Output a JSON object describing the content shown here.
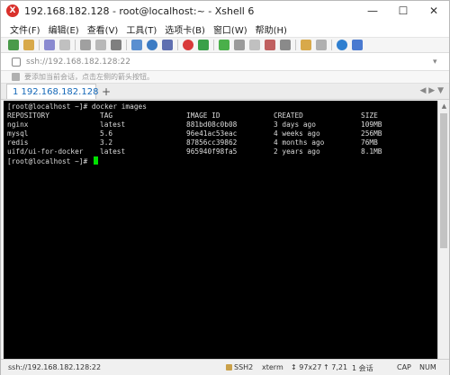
{
  "window": {
    "title": "192.168.182.128 - root@localhost:~ - Xshell 6",
    "icon": "xshell-icon"
  },
  "controls": {
    "minimize": "—",
    "maximize": "☐",
    "close": "✕"
  },
  "menu": [
    "文件(F)",
    "编辑(E)",
    "查看(V)",
    "工具(T)",
    "选项卡(B)",
    "窗口(W)",
    "帮助(H)"
  ],
  "address": {
    "value": "ssh://192.168.182.128:22"
  },
  "hint": {
    "text": "要添加当前会话，点击左侧的箭头按钮。"
  },
  "tab": {
    "label": "1 192.168.182.128",
    "add": "+",
    "nav": "◀ ▶ ▼"
  },
  "terminal": {
    "command_line": "[root@localhost ~]# docker images",
    "headers": [
      "REPOSITORY",
      "TAG",
      "IMAGE ID",
      "CREATED",
      "SIZE"
    ],
    "rows": [
      [
        "nginx",
        "latest",
        "881bd08c0b08",
        "3 days ago",
        "109MB"
      ],
      [
        "mysql",
        "5.6",
        "96e41ac53eac",
        "4 weeks ago",
        "256MB"
      ],
      [
        "redis",
        "3.2",
        "87856cc39862",
        "4 months ago",
        "76MB"
      ],
      [
        "uifd/ui-for-docker",
        "latest",
        "965940f98fa5",
        "2 years ago",
        "8.1MB"
      ]
    ],
    "prompt": "[root@localhost ~]# ",
    "colors": {
      "background": "#000000",
      "text": "#dcdcdc",
      "cursor": "#00e000"
    }
  },
  "status": {
    "address": "ssh://192.168.182.128:22",
    "protocol": "SSH2",
    "terminal_type": "xterm",
    "size": "97x27",
    "position": "7,21",
    "sessions": "1 会话",
    "caps": "CAP",
    "num": "NUM"
  },
  "colors": {
    "accent": "#1468b8"
  }
}
